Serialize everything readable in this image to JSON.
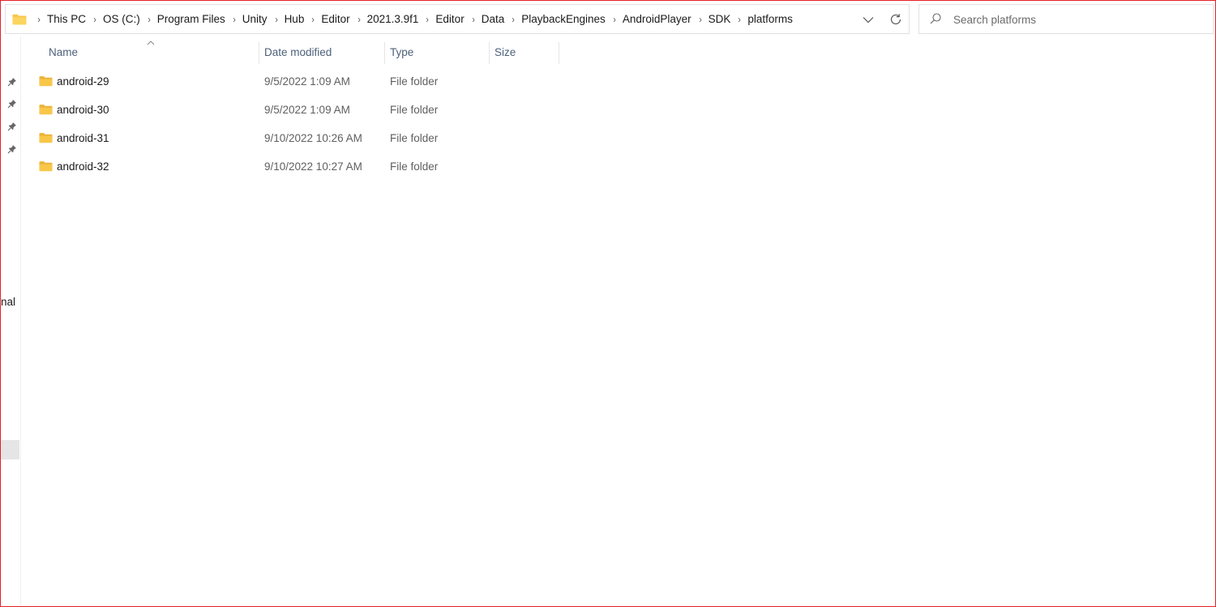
{
  "address_bar": {
    "breadcrumbs": [
      "This PC",
      "OS (C:)",
      "Program Files",
      "Unity",
      "Hub",
      "Editor",
      "2021.3.9f1",
      "Editor",
      "Data",
      "PlaybackEngines",
      "AndroidPlayer",
      "SDK",
      "platforms"
    ],
    "separator": "›",
    "folder_icon": "folder-icon",
    "dropdown_icon": "chevron-down-icon",
    "refresh_icon": "refresh-icon"
  },
  "search": {
    "placeholder": "Search platforms",
    "value": "",
    "icon": "search-icon"
  },
  "nav": {
    "pins": [
      "pin-icon",
      "pin-icon",
      "pin-icon",
      "pin-icon"
    ],
    "partial_label": "nal"
  },
  "columns": {
    "name": "Name",
    "date_modified": "Date modified",
    "type": "Type",
    "size": "Size",
    "sorted_by": "Name",
    "sort_direction": "ascending"
  },
  "files": [
    {
      "name": "android-29",
      "date_modified": "9/5/2022 1:09 AM",
      "type": "File folder",
      "size": ""
    },
    {
      "name": "android-30",
      "date_modified": "9/5/2022 1:09 AM",
      "type": "File folder",
      "size": ""
    },
    {
      "name": "android-31",
      "date_modified": "9/10/2022 10:26 AM",
      "type": "File folder",
      "size": ""
    },
    {
      "name": "android-32",
      "date_modified": "9/10/2022 10:27 AM",
      "type": "File folder",
      "size": ""
    }
  ],
  "colors": {
    "window_border": "#e8202a",
    "folder_yellow": "#f8c649",
    "header_text": "#4c607a",
    "selected_nav": "#e5e5e5"
  }
}
